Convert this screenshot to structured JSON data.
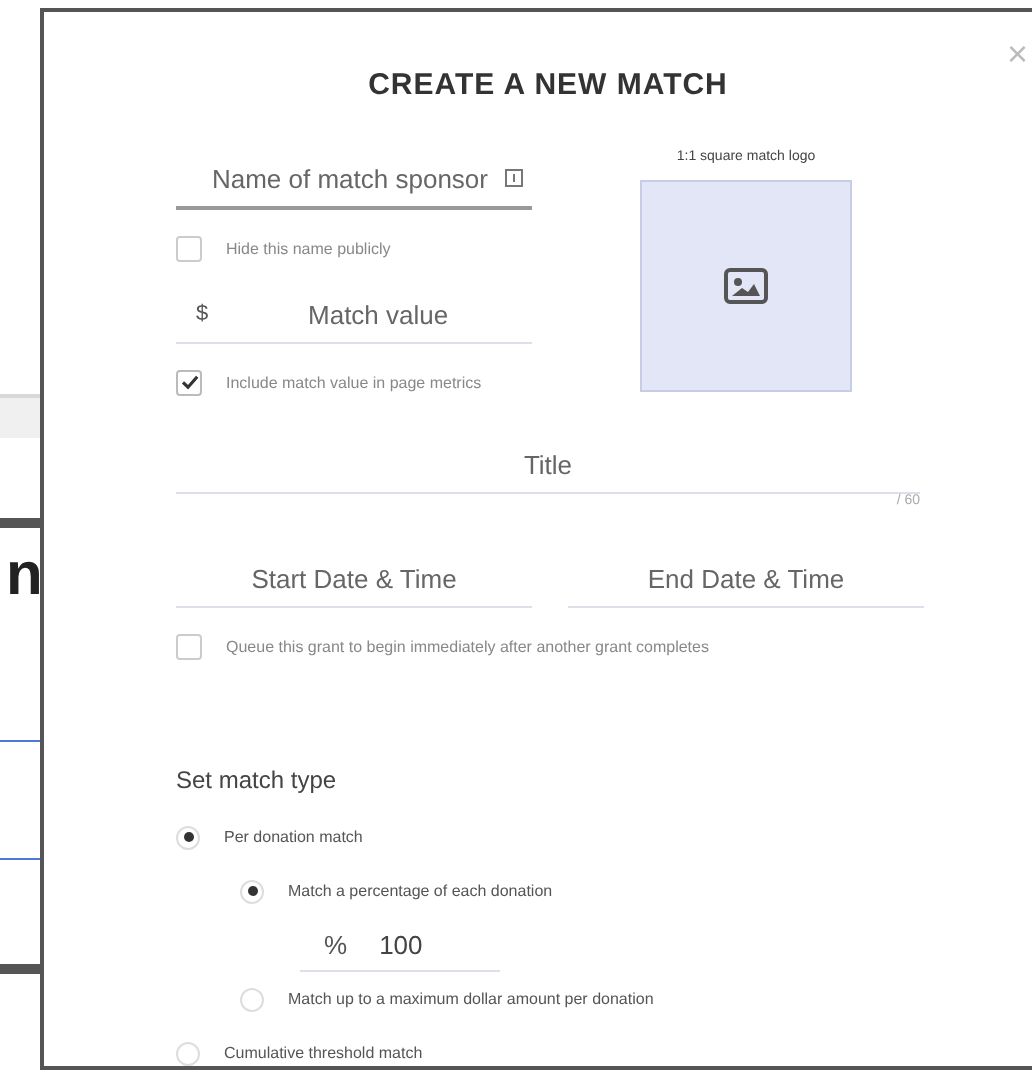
{
  "background": {
    "heading_fragment": "n"
  },
  "title": "CREATE A NEW MATCH",
  "close": "×",
  "sponsor_field": {
    "placeholder": "Name of match sponsor"
  },
  "hide_name": {
    "label": "Hide this name publicly",
    "checked": false
  },
  "match_value_field": {
    "prefix": "$",
    "placeholder": "Match value"
  },
  "include_metrics": {
    "label": "Include match value in page metrics",
    "checked": true
  },
  "logo": {
    "label": "1:1 square match logo"
  },
  "title_field": {
    "placeholder": "Title",
    "counter": "/ 60"
  },
  "start_field": {
    "placeholder": "Start Date & Time"
  },
  "end_field": {
    "placeholder": "End Date & Time"
  },
  "queue": {
    "label": "Queue this grant to begin immediately after another grant completes",
    "checked": false
  },
  "match_type": {
    "heading": "Set match type",
    "options": [
      {
        "label": "Per donation match",
        "selected": true,
        "children": [
          {
            "label": "Match a percentage of each donation",
            "selected": true,
            "field": {
              "prefix": "%",
              "value": "100"
            }
          },
          {
            "label": "Match up to a maximum dollar amount per donation",
            "selected": false
          }
        ]
      },
      {
        "label": "Cumulative threshold match",
        "selected": false
      }
    ]
  }
}
